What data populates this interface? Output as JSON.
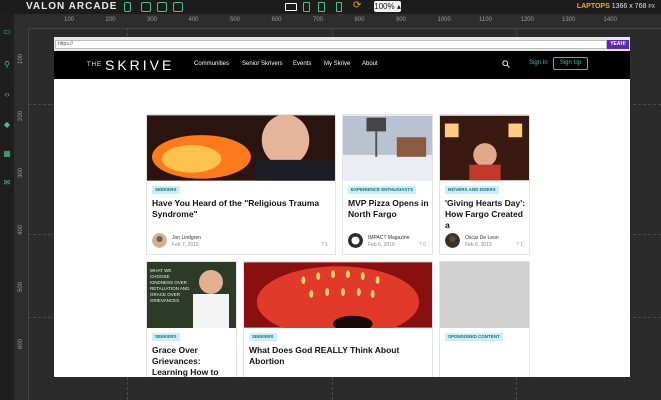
{
  "app": {
    "brand": "VALON ARCADE",
    "zoom": "100%",
    "device_label": "LAPTOPS",
    "device_resolution": "1366 x 768",
    "device_unit": "PX"
  },
  "ruler": {
    "top": [
      "100",
      "200",
      "300",
      "400",
      "500",
      "600",
      "700",
      "800",
      "900",
      "1000",
      "1100",
      "1200",
      "1300",
      "1400"
    ],
    "left": [
      "100",
      "200",
      "300",
      "400",
      "500",
      "600"
    ]
  },
  "browser": {
    "url": "https://",
    "go_label": "YEAH!"
  },
  "site": {
    "logo_the": "THE",
    "logo_main": "SKRIVE",
    "nav": [
      "Communities",
      "Senior Skrivers",
      "Events",
      "My Skrive",
      "About"
    ],
    "sign_in": "Sign In",
    "sign_up": "Sign Up"
  },
  "cards": [
    {
      "badge": "SEEKERS",
      "title": "Have You Heard of the \"Religious Trauma Syndrome\"",
      "author": "Jon Lindgren",
      "date": "Feb 7, 2019",
      "meta": "? 1"
    },
    {
      "badge": "EXPERIENCE ENTHUSIASTS",
      "title": "MVP Pizza Opens in North Fargo",
      "author": "IMPACT Magazine",
      "date": "Feb 6, 2019",
      "meta": "? 0"
    },
    {
      "badge": "MOVERS AND DOERS",
      "title": "'Giving Hearts Day': How Fargo Created a",
      "author": "Oscar De Leon",
      "date": "Feb 6, 2019",
      "meta": "? 1"
    },
    {
      "badge": "SEEKERS",
      "title": "Grace Over Grievances: Learning How to",
      "image_text": "WHAT WE CHOOSE KINDNESS OVER RETALIATION AND GRACE OVER GRIEVANCES"
    },
    {
      "badge": "SEEKERS",
      "title": "What Does God REALLY Think About Abortion"
    },
    {
      "badge": "SPONSORED CONTENT",
      "title": ""
    }
  ],
  "colors": {
    "accent": "#2ec4b6",
    "editor_accent": "#4fc08d",
    "device_label": "#f5a623",
    "url_button": "#5b2ab5"
  }
}
